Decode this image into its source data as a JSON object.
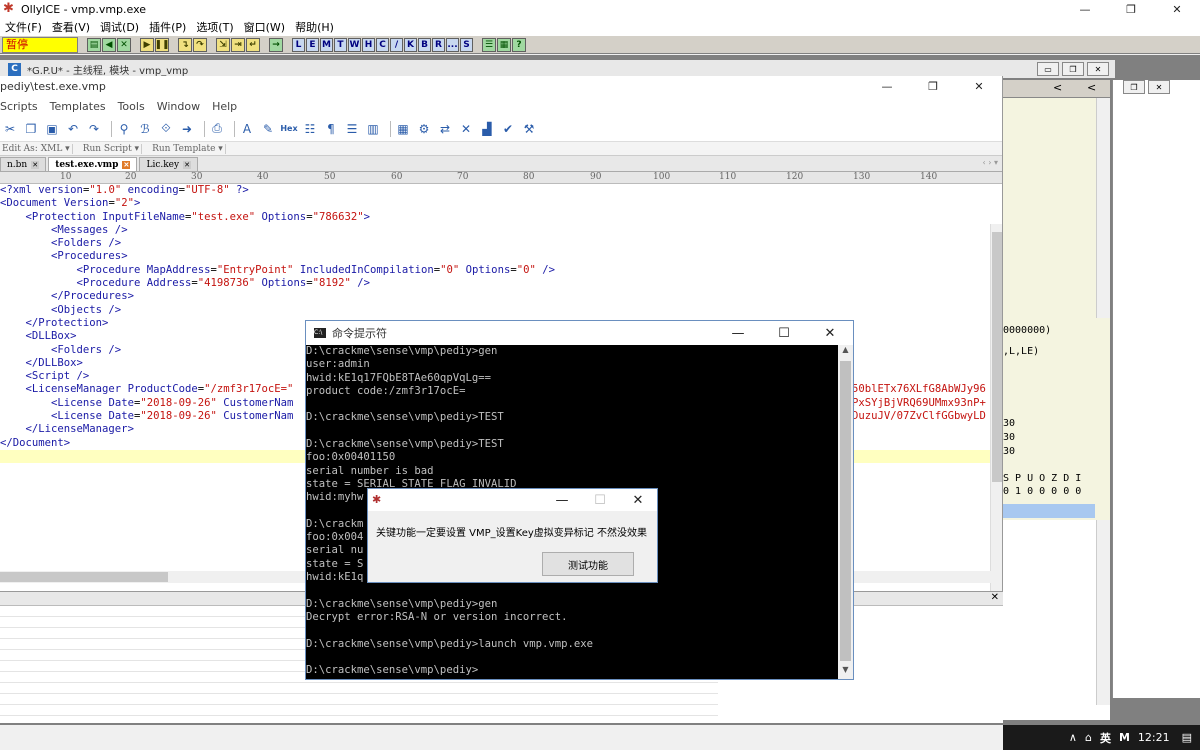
{
  "olly": {
    "title": "OllyICE - vmp.vmp.exe",
    "menu": [
      "文件(F)",
      "查看(V)",
      "调试(D)",
      "插件(P)",
      "选项(T)",
      "窗口(W)",
      "帮助(H)"
    ],
    "status": "暂停",
    "toolbar_letters": [
      "L",
      "E",
      "M",
      "T",
      "W",
      "H",
      "C",
      "/",
      "K",
      "B",
      "R",
      "...",
      "S"
    ],
    "cpu_title": "*G.P.U* - 主线程, 模块 - vmp_vmp",
    "cpu_icon": "C"
  },
  "cpu_right": {
    "nav": [
      "<",
      "<"
    ],
    "lines": [
      "0000000)",
      ",L,LE)",
      "30",
      "30",
      "30",
      "S P U O Z D I",
      "0 1 0 0 0 0 0"
    ]
  },
  "editor": {
    "title": "pediy\\test.exe.vmp",
    "menu": [
      "Scripts",
      "Templates",
      "Tools",
      "Window",
      "Help"
    ],
    "sub": [
      "Edit As: XML ▾",
      "Run Script ▾",
      "Run Template ▾"
    ],
    "tabs": [
      {
        "label": "n.bn"
      },
      {
        "label": "test.exe.vmp"
      },
      {
        "label": "Lic.key"
      }
    ],
    "ruler": [
      "10",
      "20",
      "30",
      "40",
      "50",
      "60",
      "70",
      "80",
      "90",
      "100",
      "110",
      "120",
      "130",
      "140"
    ]
  },
  "xml": {
    "l1": {
      "a": "<?xml ",
      "b": "version",
      "c": "=",
      "d": "\"1.0\"",
      "e": " encoding",
      "f": "=",
      "g": "\"UTF-8\"",
      "h": " ?>"
    },
    "l2": {
      "a": "<Document ",
      "b": "Version",
      "c": "=",
      "d": "\"2\"",
      "e": ">"
    },
    "l3": {
      "a": "<Protection ",
      "b": "InputFileName",
      "c": "=",
      "d": "\"test.exe\"",
      "e": " Options",
      "f": "=",
      "g": "\"786632\"",
      "h": ">"
    },
    "l4": "<Messages />",
    "l5": "<Folders />",
    "l6": "<Procedures>",
    "l7": {
      "a": "<Procedure ",
      "b": "MapAddress",
      "c": "=",
      "d": "\"EntryPoint\"",
      "e": " IncludedInCompilation",
      "f": "=",
      "g": "\"0\"",
      "h": " Options",
      "i": "=",
      "j": "\"0\"",
      "k": " />"
    },
    "l8": {
      "a": "<Procedure ",
      "b": "Address",
      "c": "=",
      "d": "\"4198736\"",
      "e": " Options",
      "f": "=",
      "g": "\"8192\"",
      "h": " />"
    },
    "l9": "</Procedures>",
    "l10": "<Objects />",
    "l11": "</Protection>",
    "l12": "<DLLBox>",
    "l13": "<Folders />",
    "l14": "</DLLBox>",
    "l15": "<Script />",
    "l16": {
      "a": "<LicenseManager ",
      "b": "ProductCode",
      "c": "=",
      "d": "\"/zmf3r17ocE=\"",
      "tail": "50blETx76XLfG8AbWJy96"
    },
    "l17": {
      "a": "<License ",
      "b": "Date",
      "c": "=",
      "d": "\"2018-09-26\"",
      "e": " CustomerNam",
      "tail": "PxSYjBjVRQ69UMmx93nP+"
    },
    "l18": {
      "a": "<License ",
      "b": "Date",
      "c": "=",
      "d": "\"2018-09-26\"",
      "e": " CustomerNam",
      "tail": "DuzuJV/07ZvClfGGbwyLD"
    },
    "l19": "</LicenseManager>",
    "l20": "</Document>"
  },
  "cmd": {
    "title": "命令提示符",
    "lines": [
      "D:\\crackme\\sense\\vmp\\pediy>gen",
      "user:admin",
      "hwid:kE1q17FQbE8TAe60qpVqLg==",
      "product code:/zmf3r17ocE=",
      "",
      "D:\\crackme\\sense\\vmp\\pediy>TEST",
      "",
      "D:\\crackme\\sense\\vmp\\pediy>TEST",
      "foo:0x00401150",
      "serial number is bad",
      "state = SERIAL_STATE_FLAG_INVALID",
      "hwid:myhw",
      "",
      "D:\\crackm",
      "foo:0x004",
      "serial nu",
      "state = S",
      "hwid:kE1q",
      "",
      "D:\\crackme\\sense\\vmp\\pediy>gen",
      "Decrypt error:RSA-N or version incorrect.",
      "",
      "D:\\crackme\\sense\\vmp\\pediy>launch vmp.vmp.exe",
      "",
      "D:\\crackme\\sense\\vmp\\pediy>"
    ]
  },
  "dialog": {
    "message": "关键功能一定要设置 VMP_设置Key虚拟变异标记 不然没效果",
    "button": "测试功能"
  },
  "taskbar": {
    "ime": "英",
    "m": "M",
    "time": "12:21"
  }
}
